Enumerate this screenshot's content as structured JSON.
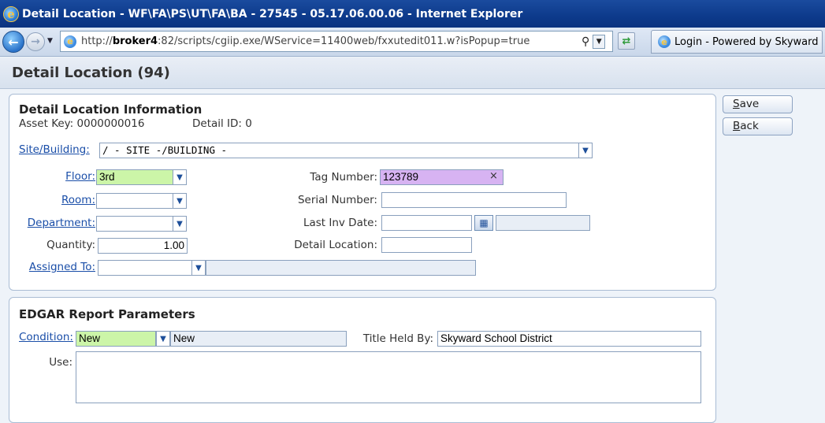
{
  "window": {
    "title": "Detail Location - WF\\FA\\PS\\UT\\FA\\BA - 27545 - 05.17.06.00.06 - Internet Explorer"
  },
  "browser": {
    "url_prefix": "http://",
    "url_host": "broker4",
    "url_rest": ":82/scripts/cgiip.exe/WService=11400web/fxxutedit011.w?isPopup=true",
    "tab_label": "Login - Powered by Skyward",
    "icons": [
      "ie-logo-icon",
      "back-arrow-icon",
      "forward-arrow-icon",
      "search-icon",
      "refresh-icon"
    ]
  },
  "page": {
    "title": "Detail Location (94)"
  },
  "detail_section": {
    "title": "Detail Location Information",
    "asset_key": "Asset Key: 0000000016",
    "detail_id": "Detail ID: 0",
    "site_building": {
      "label": "Site/Building:",
      "value": "/ - SITE -/BUILDING -"
    },
    "floor": {
      "label": "Floor:",
      "value": "3rd"
    },
    "room": {
      "label": "Room:",
      "value": ""
    },
    "department": {
      "label": "Department:",
      "value": ""
    },
    "quantity": {
      "label": "Quantity:",
      "value": "1.00"
    },
    "assigned_to": {
      "label": "Assigned To:",
      "value": "",
      "description": ""
    },
    "tag_number": {
      "label": "Tag Number:",
      "value": "123789",
      "clear": "×"
    },
    "serial_number": {
      "label": "Serial Number:",
      "value": ""
    },
    "last_inv_date": {
      "label": "Last Inv Date:",
      "value": "",
      "extra": ""
    },
    "detail_location": {
      "label": "Detail Location:",
      "value": ""
    }
  },
  "edgar_section": {
    "title": "EDGAR Report Parameters",
    "condition": {
      "label": "Condition:",
      "value": "New",
      "description": "New"
    },
    "title_held_by": {
      "label": "Title Held By:",
      "value": "Skyward School District"
    },
    "use": {
      "label": "Use:",
      "value": ""
    }
  },
  "buttons": {
    "save": {
      "accel": "S",
      "rest": "ave"
    },
    "back": {
      "accel": "B",
      "rest": "ack"
    }
  },
  "colors": {
    "required_field": "#ccf5a8",
    "focused_field": "#d7b3f2",
    "link": "#1a4ea8",
    "titlebar": "#0d3a8b"
  }
}
